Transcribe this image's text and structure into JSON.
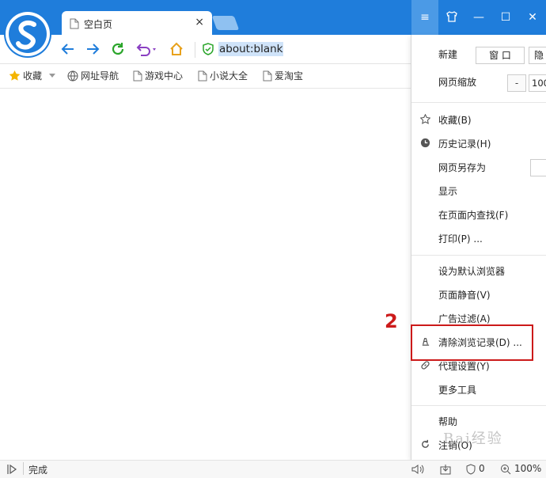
{
  "tab": {
    "title": "空白页",
    "close": "×"
  },
  "address": {
    "url": "about:blank"
  },
  "window_controls": {
    "menu": "≡",
    "skin": "👕",
    "minimize": "—",
    "maximize": "☐",
    "close": "✕"
  },
  "bookmarks": [
    {
      "label": "收藏",
      "icon": "star-icon"
    },
    {
      "label": "网址导航",
      "icon": "globe-icon"
    },
    {
      "label": "游戏中心",
      "icon": "page-icon"
    },
    {
      "label": "小说大全",
      "icon": "page-icon"
    },
    {
      "label": "爱淘宝",
      "icon": "page-icon"
    }
  ],
  "menu": {
    "new_label": "新建",
    "new_window": "窗 口",
    "new_private": "隐",
    "zoom_label": "网页缩放",
    "zoom_minus": "-",
    "zoom_value": "100",
    "items": [
      {
        "label": "收藏(B)",
        "icon": "star-outline-icon"
      },
      {
        "label": "历史记录(H)",
        "icon": "clock-icon"
      },
      {
        "label": "网页另存为",
        "icon": ""
      },
      {
        "label": "显示",
        "icon": ""
      },
      {
        "label": "在页面内查找(F)",
        "icon": ""
      },
      {
        "label": "打印(P) ...",
        "icon": ""
      },
      {
        "label": "设为默认浏览器",
        "icon": ""
      },
      {
        "label": "页面静音(V)",
        "icon": ""
      },
      {
        "label": "广告过滤(A)",
        "icon": ""
      },
      {
        "label": "清除浏览记录(D) ...",
        "icon": "eraser-icon"
      },
      {
        "label": "代理设置(Y)",
        "icon": "link-icon"
      },
      {
        "label": "更多工具",
        "icon": ""
      },
      {
        "label": "帮助",
        "icon": ""
      },
      {
        "label": "注销(O)",
        "icon": "refresh-icon"
      }
    ]
  },
  "annotation": {
    "step": "2"
  },
  "status": {
    "text": "完成",
    "counter": "0",
    "zoom": "100%"
  },
  "watermark": "Bai经验",
  "colors": {
    "titlebar": "#1f7ddb",
    "highlight": "#cc1a1a",
    "selection": "#cfe3f9"
  }
}
